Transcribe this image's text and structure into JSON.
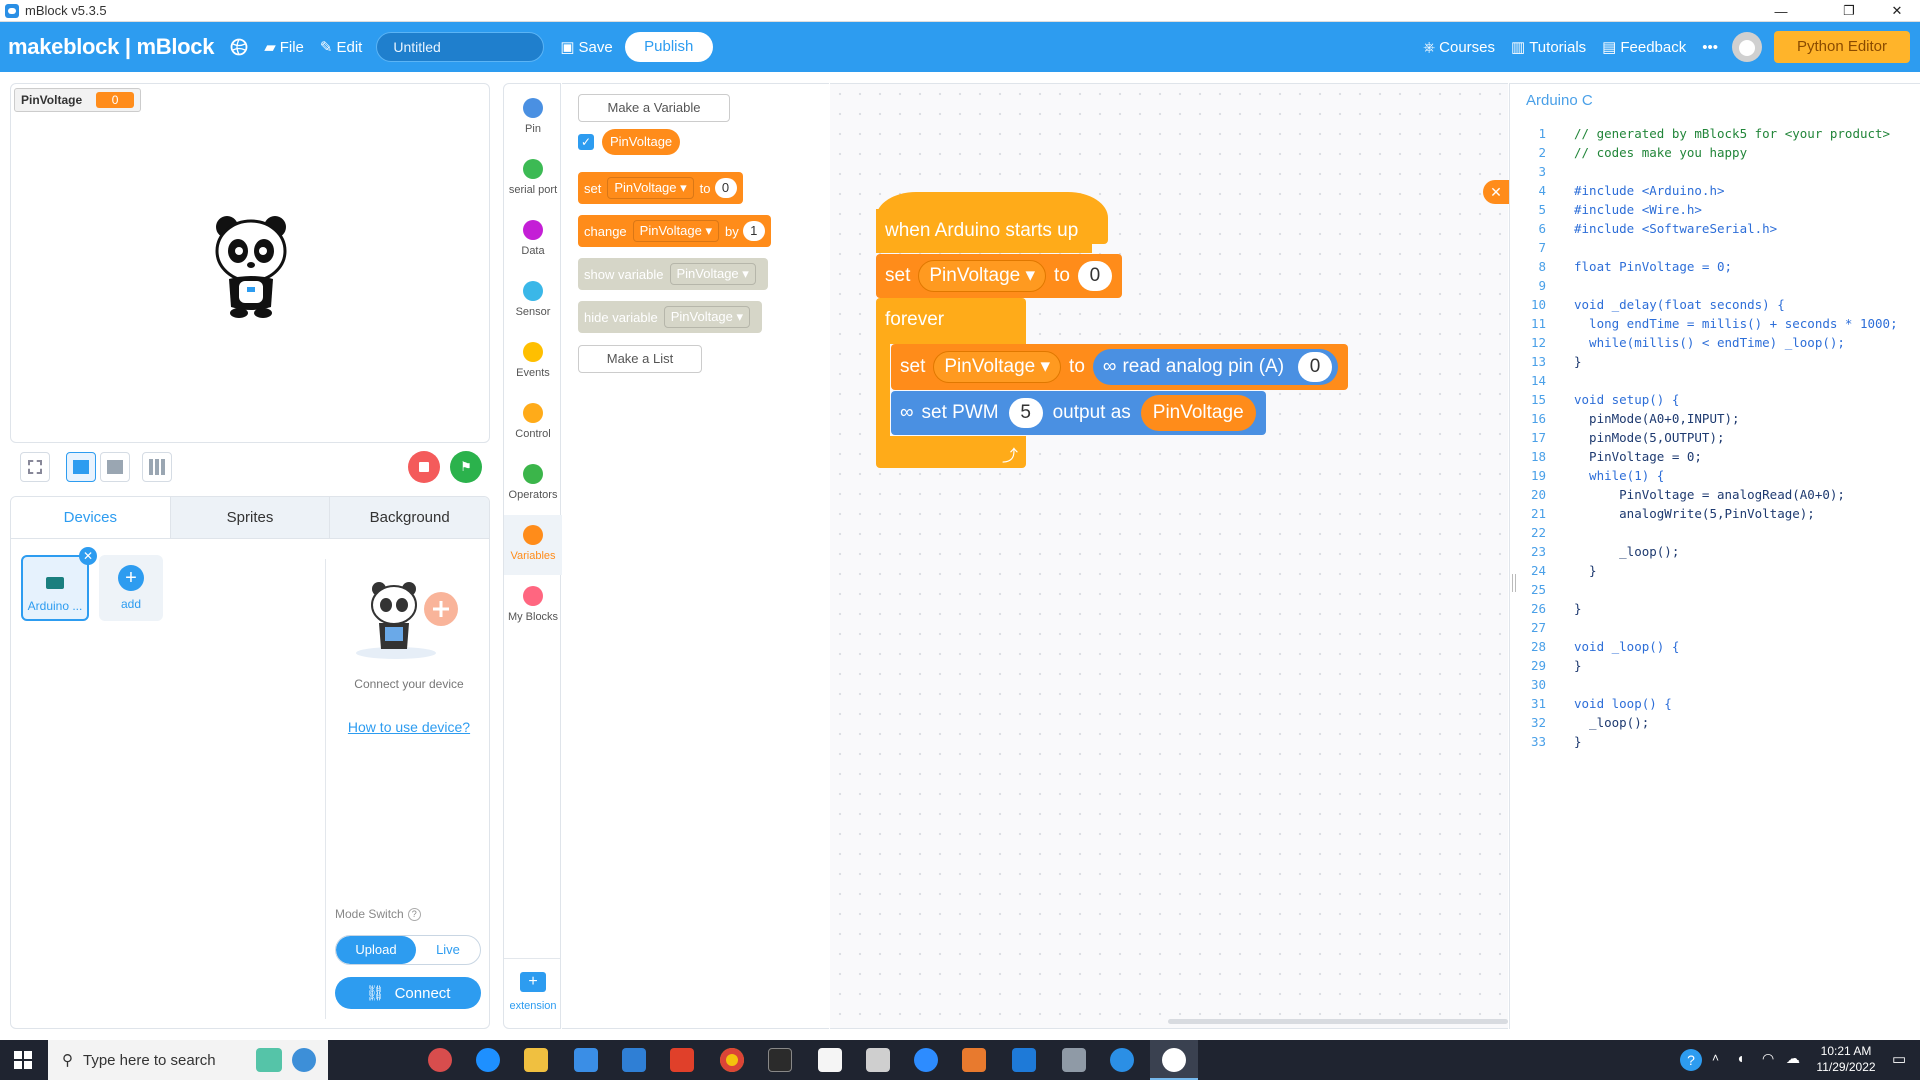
{
  "window": {
    "title": "mBlock v5.3.5",
    "controls": [
      "—",
      "❐",
      "✕"
    ]
  },
  "topbar": {
    "logo": "makeblock | mBlock",
    "file_label": "File",
    "edit_label": "Edit",
    "project_name": "Untitled",
    "save_label": "Save",
    "publish_label": "Publish",
    "courses_label": "Courses",
    "tutorials_label": "Tutorials",
    "feedback_label": "Feedback",
    "more_label": "•••",
    "python_editor_label": "Python Editor"
  },
  "stage": {
    "monitor_name": "PinVoltage",
    "monitor_value": "0"
  },
  "device_panel": {
    "tabs": [
      "Devices",
      "Sprites",
      "Background"
    ],
    "device_name": "Arduino ...",
    "add_label": "add",
    "connect_text": "Connect your device",
    "help_link": "How to use device?",
    "mode_switch_label": "Mode Switch",
    "mode_upload": "Upload",
    "mode_live": "Live",
    "connect_button": "Connect"
  },
  "categories": [
    {
      "label": "Pin",
      "color": "#4a90e2"
    },
    {
      "label": "serial port",
      "color": "#3cba54"
    },
    {
      "label": "Data",
      "color": "#c41fd6"
    },
    {
      "label": "Sensor",
      "color": "#3ab7e8"
    },
    {
      "label": "Events",
      "color": "#ffbf00"
    },
    {
      "label": "Control",
      "color": "#ffab19"
    },
    {
      "label": "Operators",
      "color": "#3bb54a"
    },
    {
      "label": "Variables",
      "color": "#ff8c1a"
    },
    {
      "label": "My Blocks",
      "color": "#ff6680"
    }
  ],
  "extension_label": "extension",
  "palette": {
    "make_variable": "Make a Variable",
    "variable_name": "PinVoltage",
    "set_label": "set",
    "to_label": "to",
    "set_value": "0",
    "change_label": "change",
    "by_label": "by",
    "change_value": "1",
    "show_label": "show variable",
    "hide_label": "hide variable",
    "make_list": "Make a List"
  },
  "workspace": {
    "hat": "when Arduino starts up",
    "set_label": "set",
    "var": "PinVoltage",
    "to_label": "to",
    "init_value": "0",
    "forever": "forever",
    "read_label": "read analog pin  (A)",
    "pin_value": "0",
    "pwm_label": "set PWM",
    "pwm_pin": "5",
    "output_label": "output as",
    "loop_arrow": "⤴"
  },
  "code_panel": {
    "title": "Arduino C",
    "lines": [
      "// generated by mBlock5 for <your product>",
      "// codes make you happy",
      "",
      "#include <Arduino.h>",
      "#include <Wire.h>",
      "#include <SoftwareSerial.h>",
      "",
      "float PinVoltage = 0;",
      "",
      "void _delay(float seconds) {",
      "  long endTime = millis() + seconds * 1000;",
      "  while(millis() < endTime) _loop();",
      "}",
      "",
      "void setup() {",
      "  pinMode(A0+0,INPUT);",
      "  pinMode(5,OUTPUT);",
      "  PinVoltage = 0;",
      "  while(1) {",
      "      PinVoltage = analogRead(A0+0);",
      "      analogWrite(5,PinVoltage);",
      "",
      "      _loop();",
      "  }",
      "",
      "}",
      "",
      "void _loop() {",
      "}",
      "",
      "void loop() {",
      "  _loop();",
      "}"
    ]
  },
  "taskbar": {
    "search_placeholder": "Type here to search",
    "time": "10:21 AM",
    "date": "11/29/2022"
  }
}
